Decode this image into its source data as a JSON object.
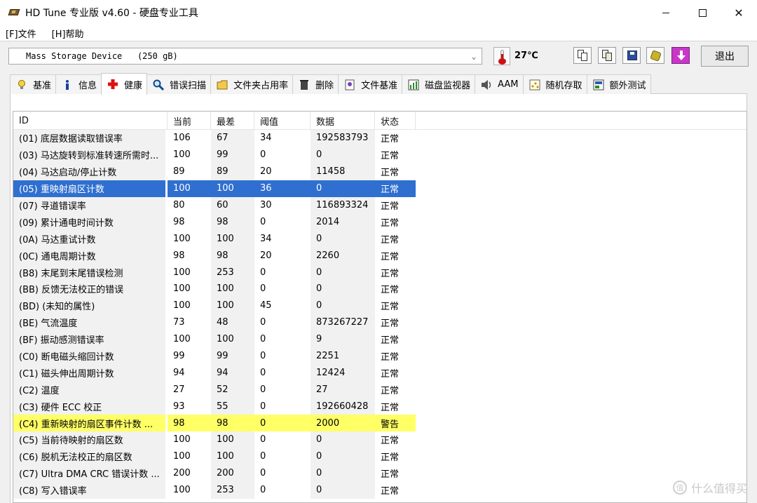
{
  "window": {
    "title": "HD Tune 专业版 v4.60 - 硬盘专业工具",
    "minimize": "—",
    "maximize": "□",
    "close": "✕"
  },
  "menu": [
    {
      "label": "[F]文件"
    },
    {
      "label": "[H]帮助"
    }
  ],
  "toolbar": {
    "drive": "Mass Storage Device   (250 gB)",
    "temperature": "27℃",
    "exit_label": "退出",
    "buttons": [
      "copy-text-icon",
      "copy-screenshot-icon",
      "save-icon",
      "options-icon",
      "download-icon"
    ]
  },
  "tabs": [
    {
      "label": "基准",
      "icon": "lightbulb-icon"
    },
    {
      "label": "信息",
      "icon": "info-icon"
    },
    {
      "label": "健康",
      "icon": "health-cross-icon"
    },
    {
      "label": "错误扫描",
      "icon": "magnifier-icon"
    },
    {
      "label": "文件夹占用率",
      "icon": "folder-icon"
    },
    {
      "label": "删除",
      "icon": "trash-icon"
    },
    {
      "label": "文件基准",
      "icon": "file-benchmark-icon"
    },
    {
      "label": "磁盘监视器",
      "icon": "monitor-chart-icon"
    },
    {
      "label": "AAM",
      "icon": "speaker-icon"
    },
    {
      "label": "随机存取",
      "icon": "random-access-icon"
    },
    {
      "label": "额外测试",
      "icon": "extra-tests-icon"
    }
  ],
  "active_tab": "健康",
  "table": {
    "columns": [
      "ID",
      "当前",
      "最差",
      "阈值",
      "数据",
      "状态"
    ],
    "rows": [
      {
        "id": "(01) 底层数据读取错误率",
        "cur": "106",
        "worst": "67",
        "thr": "34",
        "data": "192583793",
        "status": "正常"
      },
      {
        "id": "(03) 马达旋转到标准转速所需时...",
        "cur": "100",
        "worst": "99",
        "thr": "0",
        "data": "0",
        "status": "正常"
      },
      {
        "id": "(04) 马达启动/停止计数",
        "cur": "89",
        "worst": "89",
        "thr": "20",
        "data": "11458",
        "status": "正常"
      },
      {
        "id": "(05) 重映射扇区计数",
        "cur": "100",
        "worst": "100",
        "thr": "36",
        "data": "0",
        "status": "正常",
        "state": "selected"
      },
      {
        "id": "(07) 寻道错误率",
        "cur": "80",
        "worst": "60",
        "thr": "30",
        "data": "116893324",
        "status": "正常"
      },
      {
        "id": "(09) 累计通电时间计数",
        "cur": "98",
        "worst": "98",
        "thr": "0",
        "data": "2014",
        "status": "正常"
      },
      {
        "id": "(0A) 马达重试计数",
        "cur": "100",
        "worst": "100",
        "thr": "34",
        "data": "0",
        "status": "正常"
      },
      {
        "id": "(0C) 通电周期计数",
        "cur": "98",
        "worst": "98",
        "thr": "20",
        "data": "2260",
        "status": "正常"
      },
      {
        "id": "(B8) 末尾到末尾错误检测",
        "cur": "100",
        "worst": "253",
        "thr": "0",
        "data": "0",
        "status": "正常"
      },
      {
        "id": "(BB) 反馈无法校正的错误",
        "cur": "100",
        "worst": "100",
        "thr": "0",
        "data": "0",
        "status": "正常"
      },
      {
        "id": "(BD) (未知的属性)",
        "cur": "100",
        "worst": "100",
        "thr": "45",
        "data": "0",
        "status": "正常"
      },
      {
        "id": "(BE) 气流温度",
        "cur": "73",
        "worst": "48",
        "thr": "0",
        "data": "873267227",
        "status": "正常"
      },
      {
        "id": "(BF) 振动感测错误率",
        "cur": "100",
        "worst": "100",
        "thr": "0",
        "data": "9",
        "status": "正常"
      },
      {
        "id": "(C0) 断电磁头缩回计数",
        "cur": "99",
        "worst": "99",
        "thr": "0",
        "data": "2251",
        "status": "正常"
      },
      {
        "id": "(C1) 磁头伸出周期计数",
        "cur": "94",
        "worst": "94",
        "thr": "0",
        "data": "12424",
        "status": "正常"
      },
      {
        "id": "(C2) 温度",
        "cur": "27",
        "worst": "52",
        "thr": "0",
        "data": "27",
        "status": "正常"
      },
      {
        "id": "(C3) 硬件 ECC 校正",
        "cur": "93",
        "worst": "55",
        "thr": "0",
        "data": "192660428",
        "status": "正常"
      },
      {
        "id": "(C4) 重新映射的扇区事件计数 ...",
        "cur": "98",
        "worst": "98",
        "thr": "0",
        "data": "2000",
        "status": "警告",
        "state": "warning"
      },
      {
        "id": "(C5) 当前待映射的扇区数",
        "cur": "100",
        "worst": "100",
        "thr": "0",
        "data": "0",
        "status": "正常"
      },
      {
        "id": "(C6) 脱机无法校正的扇区数",
        "cur": "100",
        "worst": "100",
        "thr": "0",
        "data": "0",
        "status": "正常"
      },
      {
        "id": "(C7) Ultra DMA CRC 错误计数 ...",
        "cur": "200",
        "worst": "200",
        "thr": "0",
        "data": "0",
        "status": "正常"
      },
      {
        "id": "(C8) 写入错误率",
        "cur": "100",
        "worst": "253",
        "thr": "0",
        "data": "0",
        "status": "正常"
      }
    ]
  },
  "watermark": "什么值得买",
  "colors": {
    "selected_row": "#2f6fd0",
    "warning_row": "#ffff66",
    "temperature_accent": "#cc1111",
    "download_button": "#c837c8"
  }
}
